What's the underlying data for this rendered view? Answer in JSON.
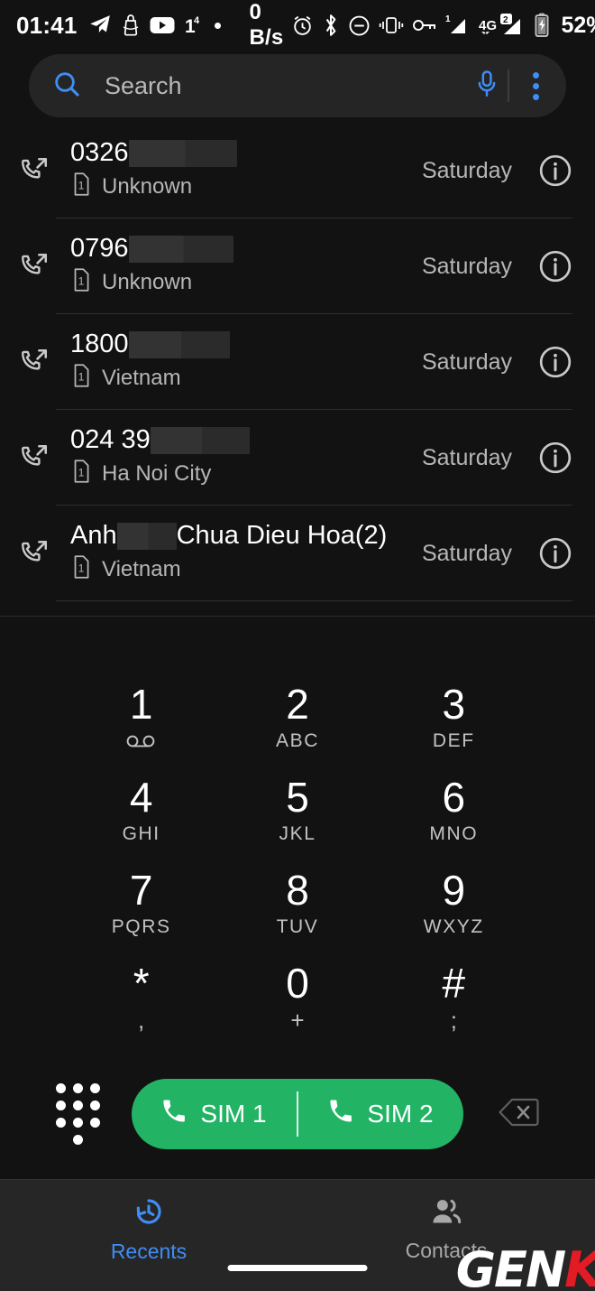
{
  "statusbar": {
    "clock": "01:41",
    "data_rate": "0 B/s",
    "battery_percent": "52%",
    "sim1_label": "1",
    "sim2_label": "2",
    "network_type": "4G",
    "notification_count": "1",
    "notification_overflow": "4",
    "icons": [
      "telegram-icon",
      "bag-icon",
      "youtube-icon",
      "notification-count-icon",
      "dot-icon",
      "alarm-icon",
      "bluetooth-icon",
      "do-not-disturb-icon",
      "vibrate-icon",
      "vpn-key-icon",
      "signal-sim1-icon",
      "signal-sim2-icon",
      "battery-charging-icon"
    ]
  },
  "search": {
    "placeholder": "Search",
    "value": "",
    "search_icon": "search-icon",
    "mic_icon": "microphone-icon",
    "overflow_icon": "more-options-icon"
  },
  "recents": {
    "rows": [
      {
        "number_prefix": "0326",
        "redact_width": 120,
        "label": "Unknown",
        "sim": "1",
        "when": "Saturday",
        "call_type": "outgoing"
      },
      {
        "number_prefix": "0796",
        "redact_width": 116,
        "label": "Unknown",
        "sim": "1",
        "when": "Saturday",
        "call_type": "outgoing"
      },
      {
        "number_prefix": "1800",
        "redact_width": 112,
        "label": "Vietnam",
        "sim": "1",
        "when": "Saturday",
        "call_type": "outgoing"
      },
      {
        "number_prefix": "024 39",
        "redact_width": 110,
        "label": "Ha Noi City",
        "sim": "1",
        "when": "Saturday",
        "call_type": "outgoing"
      },
      {
        "number_prefix": "Anh ",
        "redact_width": 66,
        "number_suffix": "Chua Dieu Hoa(2)",
        "label": "Vietnam",
        "sim": "1",
        "when": "Saturday",
        "call_type": "outgoing"
      }
    ]
  },
  "dialpad": {
    "keys": [
      {
        "num": "1",
        "sub": "",
        "sub_icon": "voicemail-icon"
      },
      {
        "num": "2",
        "sub": "ABC"
      },
      {
        "num": "3",
        "sub": "DEF"
      },
      {
        "num": "4",
        "sub": "GHI"
      },
      {
        "num": "5",
        "sub": "JKL"
      },
      {
        "num": "6",
        "sub": "MNO"
      },
      {
        "num": "7",
        "sub": "PQRS"
      },
      {
        "num": "8",
        "sub": "TUV"
      },
      {
        "num": "9",
        "sub": "WXYZ"
      },
      {
        "num": "*",
        "sub": ","
      },
      {
        "num": "0",
        "sub": "+"
      },
      {
        "num": "#",
        "sub": ";"
      }
    ]
  },
  "actionbar": {
    "dialpad_toggle_icon": "dialpad-grid-icon",
    "sim1_label": "SIM 1",
    "sim2_label": "SIM 2",
    "call_icon": "phone-icon",
    "backspace_icon": "backspace-icon",
    "call_button_color": "#22b464"
  },
  "bottomnav": {
    "items": [
      {
        "label": "Recents",
        "icon": "history-icon",
        "active": true
      },
      {
        "label": "Contacts",
        "icon": "contacts-icon",
        "active": false
      }
    ],
    "active_color": "#3f8df5",
    "inactive_color": "#a8a8a8"
  },
  "watermark": {
    "part1": "GEN",
    "part2": "K"
  }
}
